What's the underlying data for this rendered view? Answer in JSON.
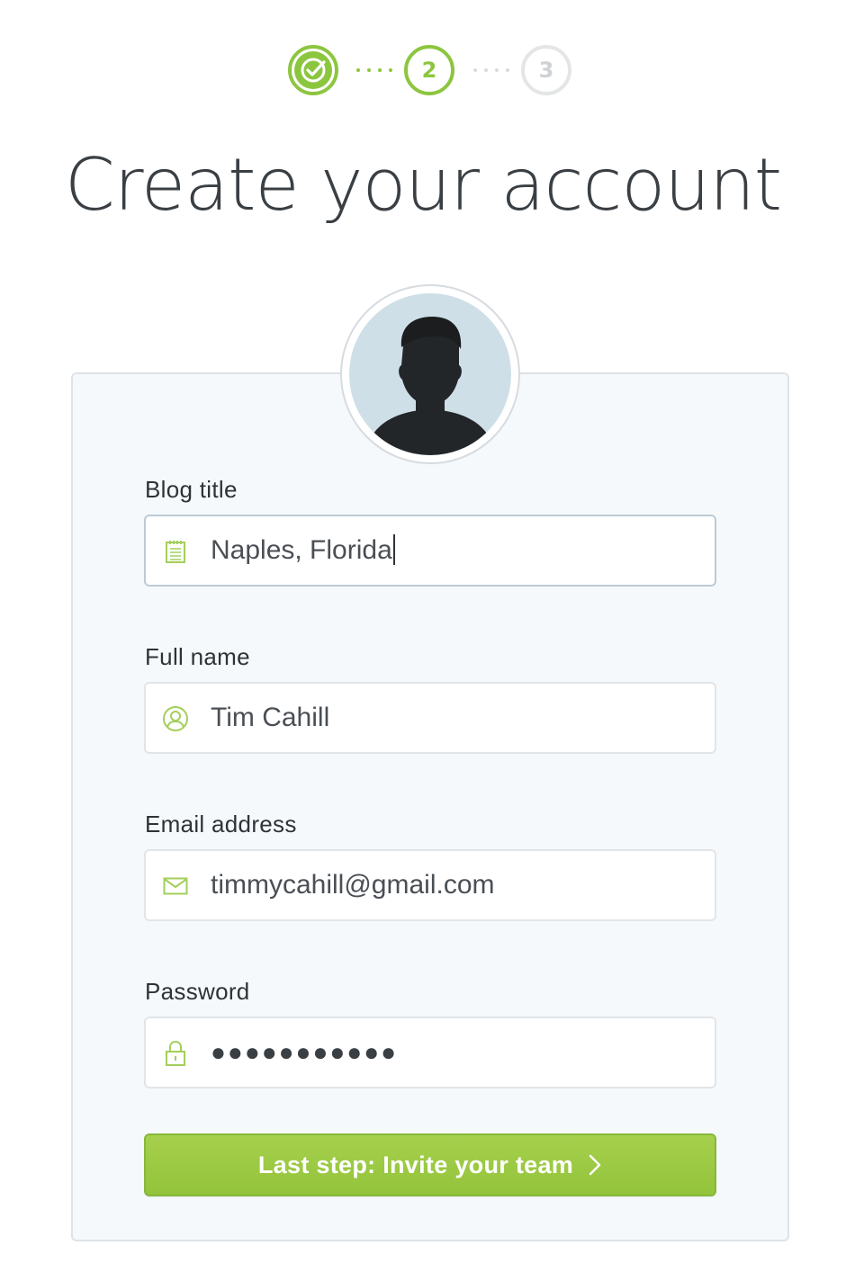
{
  "stepper": {
    "steps": [
      {
        "label": "",
        "state": "done"
      },
      {
        "label": "2",
        "state": "current"
      },
      {
        "label": "3",
        "state": "pending"
      }
    ]
  },
  "page": {
    "title": "Create your account"
  },
  "form": {
    "blog_title": {
      "label": "Blog title",
      "value": "Naples, Florida",
      "icon": "notepad-icon"
    },
    "full_name": {
      "label": "Full name",
      "value": "Tim Cahill",
      "icon": "user-circle-icon"
    },
    "email": {
      "label": "Email address",
      "value": "timmycahill@gmail.com",
      "icon": "envelope-icon"
    },
    "password": {
      "label": "Password",
      "value": "●●●●●●●●●●●",
      "icon": "lock-icon"
    },
    "submit_label": "Last step: Invite your team"
  },
  "colors": {
    "accent": "#8cc63f",
    "button": "#9bc843",
    "card_bg": "#f6f9fb",
    "avatar_bg": "#cfdfe8"
  }
}
